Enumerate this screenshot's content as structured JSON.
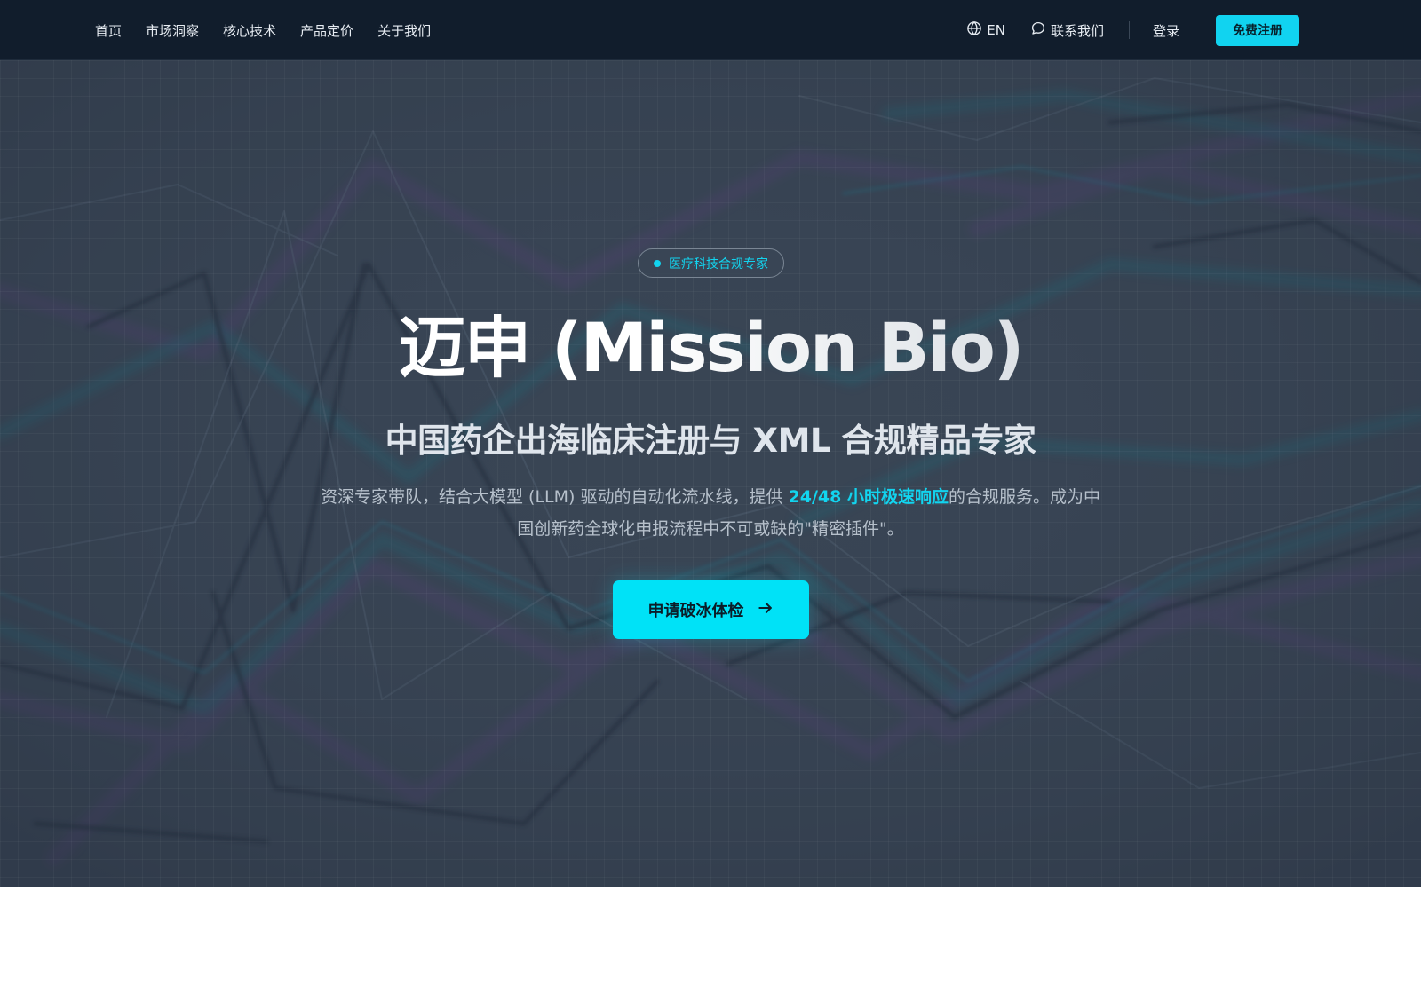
{
  "nav": {
    "links": [
      "首页",
      "市场洞察",
      "核心技术",
      "产品定价",
      "关于我们"
    ],
    "language": "EN",
    "contact": "联系我们",
    "login": "登录",
    "signup": "免费注册"
  },
  "hero": {
    "badge": "医疗科技合规专家",
    "title": "迈申 (Mission Bio)",
    "subtitle": "中国药企出海临床注册与 XML 合规精品专家",
    "desc_before": "资深专家带队，结合大模型 (LLM) 驱动的自动化流水线，提供 ",
    "desc_highlight": "24/48 小时极速响应",
    "desc_after": "的合规服务。成为中国创新药全球化申报流程中不可或缺的\"精密插件\"。",
    "cta": "申请破冰体检"
  },
  "colors": {
    "nav_bg": "#111d2c",
    "accent": "#12d4ef",
    "hero_bg": "#3a4655"
  },
  "icons": {
    "language": "globe-icon",
    "contact": "chat-bubble-icon",
    "cta": "arrow-right-icon"
  }
}
